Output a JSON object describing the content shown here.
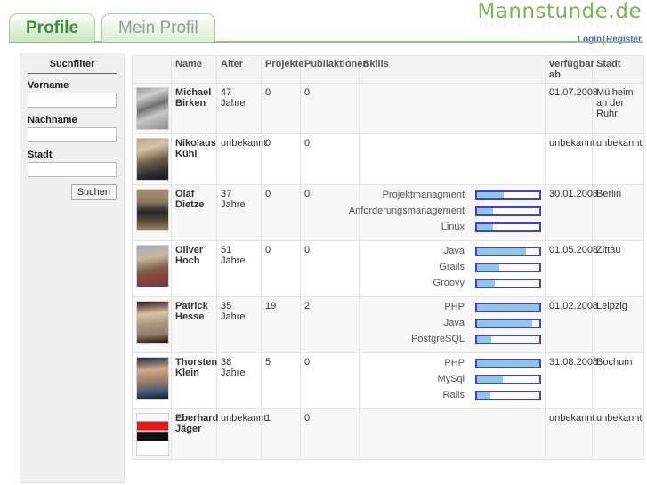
{
  "brand": {
    "name": "Mannstunde.de",
    "login_label": "Login",
    "separator": "|",
    "register_label": "Register"
  },
  "tabs": [
    {
      "label": "Profile",
      "active": true
    },
    {
      "label": "Mein Profil",
      "active": false
    }
  ],
  "sidebar": {
    "title": "Suchfilter",
    "fields": [
      {
        "label": "Vorname",
        "value": "",
        "placeholder": ""
      },
      {
        "label": "Nachname",
        "value": "",
        "placeholder": ""
      },
      {
        "label": "Stadt",
        "value": "",
        "placeholder": ""
      }
    ],
    "search_button": "Suchen"
  },
  "table": {
    "columns": [
      "",
      "Name",
      "Alter",
      "Projekte",
      "Publiaktionen",
      "Skills",
      "verfügbar ab",
      "Stadt"
    ],
    "rows": [
      {
        "photo": "portrait-michael-birken",
        "name": "Michael Birken",
        "alter": "47 Jahre",
        "projekte": "0",
        "publikationen": "0",
        "skills": [],
        "verfuegbar_ab": "01.07.2008",
        "stadt": "Mülheim an der Ruhr"
      },
      {
        "photo": "portrait-nikolaus-kuehl",
        "name": "Nikolaus Kühl",
        "alter": "unbekannt",
        "projekte": "0",
        "publikationen": "0",
        "skills": [],
        "verfuegbar_ab": "unbekannt",
        "stadt": "unbekannt"
      },
      {
        "photo": "portrait-olaf-dietze",
        "name": "Olaf Dietze",
        "alter": "37 Jahre",
        "projekte": "0",
        "publikationen": "0",
        "skills": [
          {
            "label": "Projektmanagment",
            "level": 43
          },
          {
            "label": "Anforderungsmanagement",
            "level": 25
          },
          {
            "label": "Linux",
            "level": 25
          }
        ],
        "verfuegbar_ab": "30.01.2008",
        "stadt": "Berlin"
      },
      {
        "photo": "portrait-oliver-hoch",
        "name": "Oliver Hoch",
        "alter": "51 Jahre",
        "projekte": "0",
        "publikationen": "0",
        "skills": [
          {
            "label": "Java",
            "level": 78
          },
          {
            "label": "Grails",
            "level": 36
          },
          {
            "label": "Groovy",
            "level": 28
          }
        ],
        "verfuegbar_ab": "01.05.2008",
        "stadt": "Zittau"
      },
      {
        "photo": "portrait-patrick-hesse",
        "name": "Patrick Hesse",
        "alter": "35 Jahre",
        "projekte": "19",
        "publikationen": "2",
        "skills": [
          {
            "label": "PHP",
            "level": 100
          },
          {
            "label": "Java",
            "level": 88
          },
          {
            "label": "PostgreSQL",
            "level": 23
          }
        ],
        "verfuegbar_ab": "01.02.2008",
        "stadt": "Leipzig"
      },
      {
        "photo": "portrait-thorsten-klein",
        "name": "Thorsten Klein",
        "alter": "38 Jahre",
        "projekte": "5",
        "publikationen": "0",
        "skills": [
          {
            "label": "PHP",
            "level": 100
          },
          {
            "label": "MySql",
            "level": 42
          },
          {
            "label": "Rails",
            "level": 22
          }
        ],
        "verfuegbar_ab": "31.08.2008",
        "stadt": "Bochum"
      },
      {
        "photo": "logo-asspro",
        "name": "Eberhard Jäger",
        "alter": "unbekannt",
        "projekte": "1",
        "publikationen": "0",
        "skills": [],
        "verfuegbar_ab": "unbekannt",
        "stadt": "unbekannt"
      }
    ]
  },
  "colors": {
    "brand_green": "#77b555",
    "tab_active_text": "#3d8c3d",
    "tab_inactive_text": "#9a9a9a",
    "link_blue": "#4a63c8",
    "skill_bar_border": "#3f3fe0",
    "skill_bar_fill": "#90c9dd"
  }
}
